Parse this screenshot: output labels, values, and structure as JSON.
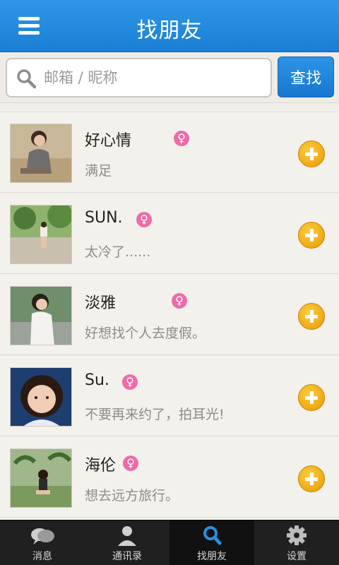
{
  "header": {
    "title": "找朋友"
  },
  "search": {
    "placeholder": "邮箱 / 昵称",
    "button_label": "查找"
  },
  "friends": [
    {
      "name": "好心情",
      "gender": "♀",
      "status": "满足"
    },
    {
      "name": "SUN.",
      "gender": "♀",
      "status": "太冷了......"
    },
    {
      "name": "淡雅",
      "gender": "♀",
      "status": "好想找个人去度假。"
    },
    {
      "name": "Su.",
      "gender": "♀",
      "status": "不要再来约了，拍耳光!"
    },
    {
      "name": "海伦",
      "gender": "♀",
      "status": "想去远方旅行。"
    }
  ],
  "tabs": [
    {
      "label": "消息",
      "icon": "chat-icon"
    },
    {
      "label": "通讯录",
      "icon": "contacts-icon"
    },
    {
      "label": "找朋友",
      "icon": "search-icon",
      "active": true
    },
    {
      "label": "设置",
      "icon": "gear-icon"
    }
  ],
  "colors": {
    "accent": "#1a7fd6",
    "gender_female": "#ef6aa8",
    "add_button": "#f0a500"
  }
}
